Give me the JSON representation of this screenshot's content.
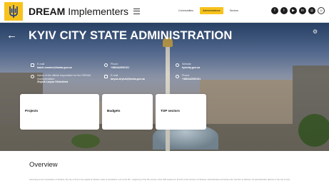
{
  "header": {
    "brand_bold": "DREAM",
    "brand_rest": "Implementers",
    "nav": [
      {
        "label": "Communities",
        "active": false
      },
      {
        "label": "Administrations",
        "active": true
      },
      {
        "label": "Sectors",
        "active": false
      }
    ],
    "socials": [
      {
        "icon": "facebook-icon",
        "glyph": "f"
      },
      {
        "icon": "twitter-icon",
        "glyph": "t"
      },
      {
        "icon": "youtube-icon",
        "glyph": "▶"
      },
      {
        "icon": "linkedin-icon",
        "glyph": "in"
      },
      {
        "icon": "instagram-icon",
        "glyph": "◎"
      },
      {
        "icon": "user-icon",
        "glyph": "☺"
      }
    ],
    "accent_color": "#f7c21c"
  },
  "hero": {
    "title": "KYIV CITY STATE ADMINISTRATION",
    "back_glyph": "←",
    "gear_glyph": "⚙",
    "contacts": {
      "email_label": "E-mail",
      "email_value": "batch.remdev@kmda.gov.ua",
      "phone_label": "Phone",
      "phone_value": "+380442000101",
      "web_label": "Website",
      "web_value": "kyivcity.gov.ua",
      "official_label": "Name of the official responsible for the DREAM implementation",
      "official_value": "Zhyluk Larysa Oleksiivna",
      "official_email_label": "E-mail",
      "official_email_value": "larysa.zhyluk@kmda.gov.ua",
      "official_phone_label": "Phone",
      "official_phone_value": "+380442000101"
    },
    "cards": [
      {
        "label": "Projects"
      },
      {
        "label": "Budgets"
      },
      {
        "label": "TOP sectors"
      }
    ]
  },
  "overview": {
    "title": "Overview",
    "text": "According to the Constitution of Ukraine, the city of Kyiv is the capital of Ukraine. Date of foundation: end of the 5th - beginning of the 6th century. Area: 836 square km (0.14% of the territory of Ukraine). Administrative-territorial units: Number of districts: 10 administrative districts in the city of Kyiv."
  }
}
